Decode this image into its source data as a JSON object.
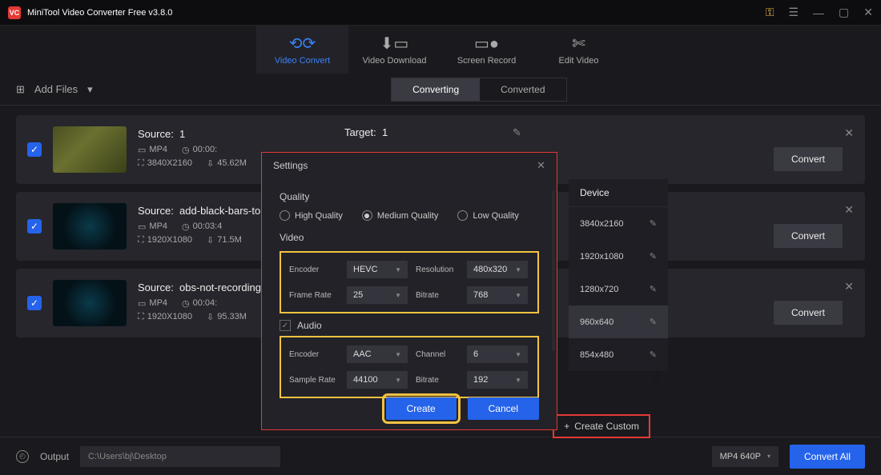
{
  "app": {
    "title": "MiniTool Video Converter Free v3.8.0"
  },
  "nav": {
    "tabs": [
      {
        "label": "Video Convert"
      },
      {
        "label": "Video Download"
      },
      {
        "label": "Screen Record"
      },
      {
        "label": "Edit Video"
      }
    ]
  },
  "toolbar": {
    "add_files": "Add Files",
    "segments": [
      {
        "label": "Converting"
      },
      {
        "label": "Converted"
      }
    ]
  },
  "files": [
    {
      "source_label": "Source:",
      "source_name": "1",
      "format": "MP4",
      "duration": "00:00:",
      "res": "3840X2160",
      "size": "45.62M",
      "target_label": "Target:",
      "target_name": "1",
      "convert": "Convert"
    },
    {
      "source_label": "Source:",
      "source_name": "add-black-bars-to",
      "format": "MP4",
      "duration": "00:03:4",
      "res": "1920X1080",
      "size": "71.5M",
      "convert": "Convert"
    },
    {
      "source_label": "Source:",
      "source_name": "obs-not-recording",
      "format": "MP4",
      "duration": "00:04:",
      "res": "1920X1080",
      "size": "95.33M",
      "convert": "Convert"
    }
  ],
  "res_panel": {
    "header": "Device",
    "items": [
      {
        "label": "3840x2160"
      },
      {
        "label": "1920x1080"
      },
      {
        "label": "1280x720"
      },
      {
        "label": "960x640",
        "selected": true
      },
      {
        "label": "854x480"
      }
    ]
  },
  "create_custom": "Create Custom",
  "modal": {
    "title": "Settings",
    "quality": {
      "label": "Quality",
      "options": [
        {
          "label": "High Quality"
        },
        {
          "label": "Medium Quality",
          "checked": true
        },
        {
          "label": "Low Quality"
        }
      ]
    },
    "video": {
      "label": "Video",
      "encoder_label": "Encoder",
      "encoder": "HEVC",
      "resolution_label": "Resolution",
      "resolution": "480x320",
      "framerate_label": "Frame Rate",
      "framerate": "25",
      "bitrate_label": "Bitrate",
      "bitrate": "768"
    },
    "audio": {
      "label": "Audio",
      "encoder_label": "Encoder",
      "encoder": "AAC",
      "channel_label": "Channel",
      "channel": "6",
      "samplerate_label": "Sample Rate",
      "samplerate": "44100",
      "bitrate_label": "Bitrate",
      "bitrate": "192"
    },
    "create": "Create",
    "cancel": "Cancel"
  },
  "footer": {
    "output_label": "Output",
    "output_path": "C:\\Users\\bj\\Desktop",
    "format": "MP4 640P",
    "convert_all": "Convert All"
  }
}
